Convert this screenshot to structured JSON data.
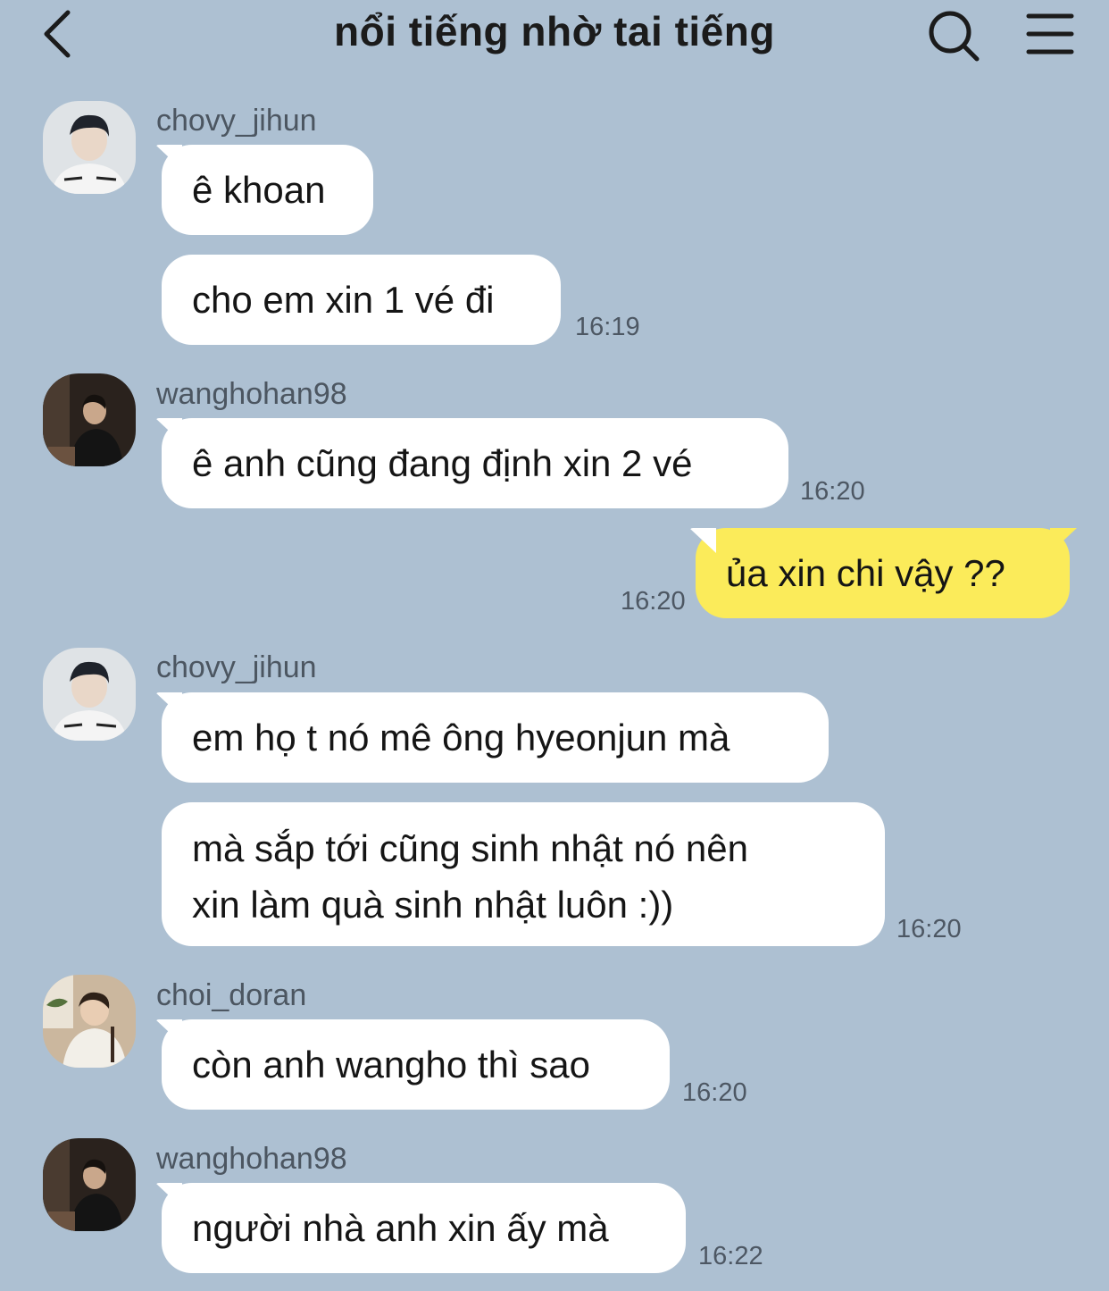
{
  "header": {
    "title": "nổi tiếng nhờ tai tiếng"
  },
  "colors": {
    "background": "#adc0d2",
    "bubble_other": "#ffffff",
    "bubble_me": "#fbeb5a"
  },
  "messages": [
    {
      "sender": "chovy_jihun",
      "bubbles": [
        "ê khoan",
        "cho em xin 1 vé đi"
      ],
      "time": "16:19"
    },
    {
      "sender": "wanghohan98",
      "bubbles": [
        "ê anh cũng đang định xin 2 vé"
      ],
      "time": "16:20"
    },
    {
      "sender": "me",
      "bubbles": [
        "ủa xin chi vậy ??"
      ],
      "time": "16:20"
    },
    {
      "sender": "chovy_jihun",
      "bubbles": [
        "em họ t nó mê ông hyeonjun mà",
        [
          "mà sắp tới cũng sinh nhật nó nên",
          "xin làm quà sinh nhật luôn :))"
        ]
      ],
      "time": "16:20"
    },
    {
      "sender": "choi_doran",
      "bubbles": [
        "còn anh wangho thì sao"
      ],
      "time": "16:20"
    },
    {
      "sender": "wanghohan98",
      "bubbles": [
        "người nhà anh xin ấy mà"
      ],
      "time": "16:22"
    }
  ]
}
